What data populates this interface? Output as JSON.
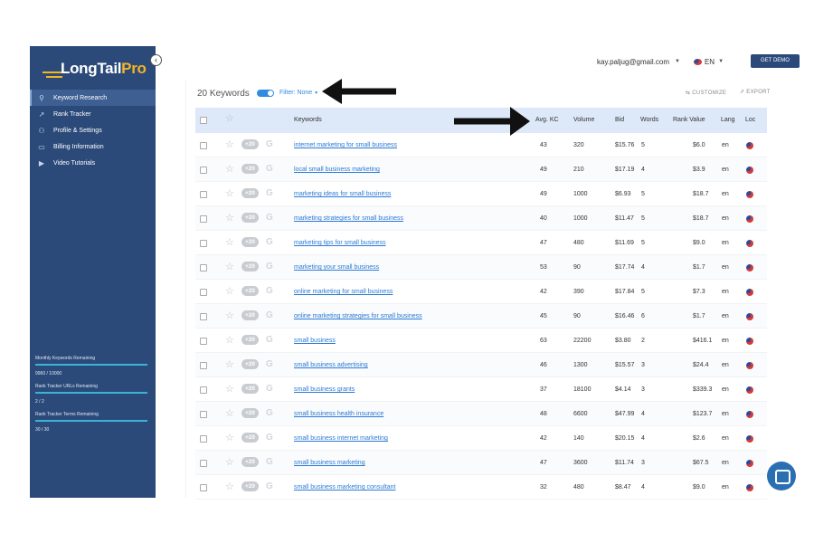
{
  "sidebar": {
    "logo": {
      "part1": "LongTail",
      "part2": "Pro"
    },
    "collapse_glyph": "‹",
    "items": [
      {
        "label": "Keyword Research",
        "icon": "search-icon",
        "glyph": "⚲",
        "active": true
      },
      {
        "label": "Rank Tracker",
        "icon": "trend-icon",
        "glyph": "↗",
        "active": false
      },
      {
        "label": "Profile & Settings",
        "icon": "user-icon",
        "glyph": "⚇",
        "active": false
      },
      {
        "label": "Billing Information",
        "icon": "card-icon",
        "glyph": "▭",
        "active": false
      },
      {
        "label": "Video Tutorials",
        "icon": "video-icon",
        "glyph": "▶",
        "active": false
      }
    ],
    "stats": [
      {
        "label": "Monthly Keywords Remaining",
        "value": "9960 / 10000",
        "fraction": 0.996
      },
      {
        "label": "Rank Tracker URLs Remaining",
        "value": "2 / 2",
        "fraction": 1.0
      },
      {
        "label": "Rank Tracker Terms Remaining",
        "value": "30 / 30",
        "fraction": 1.0
      }
    ]
  },
  "header": {
    "email": "kay.paljug@gmail.com",
    "language": "EN",
    "demo_button": "GET DEMO"
  },
  "main": {
    "title": "20 Keywords",
    "filter_label": "Filter:",
    "filter_value": "None",
    "customize": "CUSTOMIZE",
    "export": "EXPORT",
    "columns": {
      "keywords": "Keywords",
      "avg_kc": "Avg. KC",
      "volume": "Volume",
      "bid": "Bid",
      "words": "Words",
      "rank_value": "Rank Value",
      "lang": "Lang",
      "loc": "Loc"
    },
    "pill_label": "+20",
    "g_glyph": "G",
    "star_glyph": "☆",
    "rows": [
      {
        "keyword": "internet marketing for small business",
        "kc": "43",
        "volume": "320",
        "bid": "$15.76",
        "words": "5",
        "rank_value": "$6.0",
        "lang": "en"
      },
      {
        "keyword": "local small business marketing",
        "kc": "49",
        "volume": "210",
        "bid": "$17.19",
        "words": "4",
        "rank_value": "$3.9",
        "lang": "en"
      },
      {
        "keyword": "marketing ideas for small business",
        "kc": "49",
        "volume": "1000",
        "bid": "$6.93",
        "words": "5",
        "rank_value": "$18.7",
        "lang": "en"
      },
      {
        "keyword": "marketing strategies for small business",
        "kc": "40",
        "volume": "1000",
        "bid": "$11.47",
        "words": "5",
        "rank_value": "$18.7",
        "lang": "en"
      },
      {
        "keyword": "marketing tips for small business",
        "kc": "47",
        "volume": "480",
        "bid": "$11.69",
        "words": "5",
        "rank_value": "$9.0",
        "lang": "en"
      },
      {
        "keyword": "marketing your small business",
        "kc": "53",
        "volume": "90",
        "bid": "$17.74",
        "words": "4",
        "rank_value": "$1.7",
        "lang": "en"
      },
      {
        "keyword": "online marketing for small business",
        "kc": "42",
        "volume": "390",
        "bid": "$17.84",
        "words": "5",
        "rank_value": "$7.3",
        "lang": "en"
      },
      {
        "keyword": "online marketing strategies for small business",
        "kc": "45",
        "volume": "90",
        "bid": "$16.46",
        "words": "6",
        "rank_value": "$1.7",
        "lang": "en"
      },
      {
        "keyword": "small business",
        "kc": "63",
        "volume": "22200",
        "bid": "$3.80",
        "words": "2",
        "rank_value": "$416.1",
        "lang": "en"
      },
      {
        "keyword": "small business advertising",
        "kc": "46",
        "volume": "1300",
        "bid": "$15.57",
        "words": "3",
        "rank_value": "$24.4",
        "lang": "en"
      },
      {
        "keyword": "small business grants",
        "kc": "37",
        "volume": "18100",
        "bid": "$4.14",
        "words": "3",
        "rank_value": "$339.3",
        "lang": "en"
      },
      {
        "keyword": "small business health insurance",
        "kc": "48",
        "volume": "6600",
        "bid": "$47.99",
        "words": "4",
        "rank_value": "$123.7",
        "lang": "en"
      },
      {
        "keyword": "small business internet marketing",
        "kc": "42",
        "volume": "140",
        "bid": "$20.15",
        "words": "4",
        "rank_value": "$2.6",
        "lang": "en"
      },
      {
        "keyword": "small business marketing",
        "kc": "47",
        "volume": "3600",
        "bid": "$11.74",
        "words": "3",
        "rank_value": "$67.5",
        "lang": "en"
      },
      {
        "keyword": "small business marketing consultant",
        "kc": "32",
        "volume": "480",
        "bid": "$8.47",
        "words": "4",
        "rank_value": "$9.0",
        "lang": "en"
      }
    ]
  },
  "colors": {
    "sidebar_bg": "#2b4a7a",
    "accent": "#2f8ce0",
    "brand_yellow": "#f5b523",
    "header_row": "#dde8f8"
  }
}
